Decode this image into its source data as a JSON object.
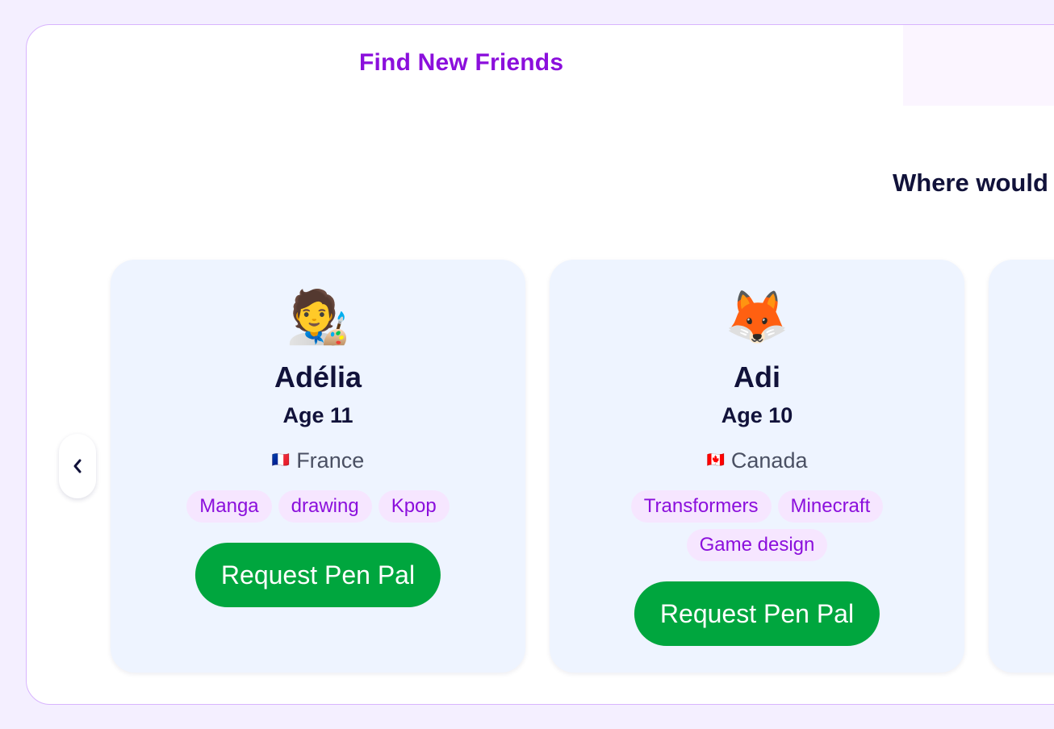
{
  "header": {
    "title": "Find New Friends",
    "question": "Where would"
  },
  "carousel": {
    "prev_icon": "chevron-left-icon",
    "cards": [
      {
        "avatar": "🧑‍🎨",
        "name": "Adélia",
        "age": "Age 11",
        "flag": "🇫🇷",
        "country": "France",
        "tags": [
          "Manga",
          "drawing",
          "Kpop"
        ],
        "button": "Request Pen Pal"
      },
      {
        "avatar": "🦊",
        "name": "Adi",
        "age": "Age 10",
        "flag": "🇨🇦",
        "country": "Canada",
        "tags": [
          "Transformers",
          "Minecraft",
          "Game design"
        ],
        "button": "Request Pen Pal"
      }
    ]
  },
  "colors": {
    "accent": "#8b0fdc",
    "button": "#00a63e",
    "card": "#eef4ff",
    "tag": "#f6e6ff",
    "background": "#f4efff"
  }
}
